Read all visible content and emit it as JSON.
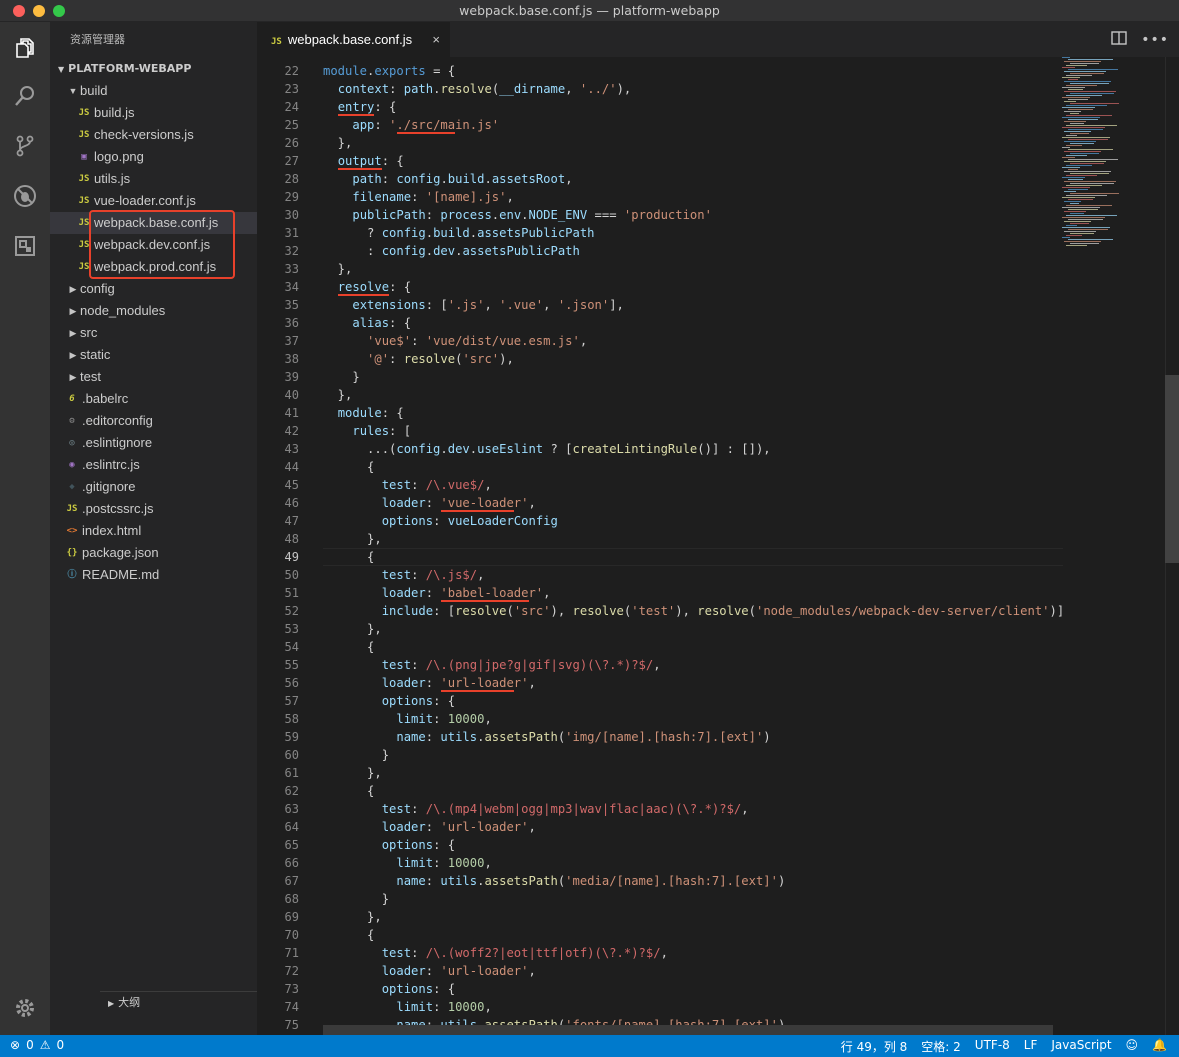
{
  "window": {
    "title": "webpack.base.conf.js — platform-webapp"
  },
  "activity_bar": {
    "items": [
      "explorer-icon",
      "search-icon",
      "source-control-icon",
      "debug-icon",
      "extensions-icon"
    ],
    "bottom": "gear-icon"
  },
  "sidebar": {
    "header": "资源管理器",
    "section": "PLATFORM-WEBAPP",
    "tree": [
      {
        "label": "build",
        "type": "folder-open",
        "depth": 0
      },
      {
        "label": "build.js",
        "type": "js",
        "depth": 1
      },
      {
        "label": "check-versions.js",
        "type": "js",
        "depth": 1
      },
      {
        "label": "logo.png",
        "type": "img",
        "depth": 1
      },
      {
        "label": "utils.js",
        "type": "js",
        "depth": 1
      },
      {
        "label": "vue-loader.conf.js",
        "type": "js",
        "depth": 1
      },
      {
        "label": "webpack.base.conf.js",
        "type": "js",
        "depth": 1,
        "selected": true
      },
      {
        "label": "webpack.dev.conf.js",
        "type": "js",
        "depth": 1
      },
      {
        "label": "webpack.prod.conf.js",
        "type": "js",
        "depth": 1
      },
      {
        "label": "config",
        "type": "folder",
        "depth": 0
      },
      {
        "label": "node_modules",
        "type": "folder",
        "depth": 0
      },
      {
        "label": "src",
        "type": "folder",
        "depth": 0
      },
      {
        "label": "static",
        "type": "folder",
        "depth": 0
      },
      {
        "label": "test",
        "type": "folder",
        "depth": 0
      },
      {
        "label": ".babelrc",
        "type": "babel",
        "depth": 0
      },
      {
        "label": ".editorconfig",
        "type": "cfg",
        "depth": 0
      },
      {
        "label": ".eslintignore",
        "type": "eslintig",
        "depth": 0
      },
      {
        "label": ".eslintrc.js",
        "type": "eslintrc",
        "depth": 0
      },
      {
        "label": ".gitignore",
        "type": "git",
        "depth": 0
      },
      {
        "label": ".postcssrc.js",
        "type": "js",
        "depth": 0
      },
      {
        "label": "index.html",
        "type": "html",
        "depth": 0
      },
      {
        "label": "package.json",
        "type": "json",
        "depth": 0
      },
      {
        "label": "README.md",
        "type": "info",
        "depth": 0
      }
    ],
    "outline": "大纲"
  },
  "tab": {
    "icon": "JS",
    "label": "webpack.base.conf.js",
    "close": "×"
  },
  "tab_actions": [
    "split-editor-icon",
    "more-icon"
  ],
  "editor": {
    "first_line": 22,
    "current_line": 49,
    "lines": [
      [
        [
          "k",
          "module"
        ],
        [
          "p",
          "."
        ],
        [
          "k",
          "exports"
        ],
        [
          "p",
          " = {"
        ]
      ],
      [
        [
          "p",
          "  "
        ],
        [
          "v",
          "context"
        ],
        [
          "p",
          ": "
        ],
        [
          "v",
          "path"
        ],
        [
          "p",
          "."
        ],
        [
          "f",
          "resolve"
        ],
        [
          "p",
          "("
        ],
        [
          "v",
          "__dirname"
        ],
        [
          "p",
          ", "
        ],
        [
          "s",
          "'../'"
        ],
        [
          "p",
          "),"
        ]
      ],
      [
        [
          "p",
          "  "
        ],
        [
          "v",
          "entry"
        ],
        [
          "p",
          ": {"
        ]
      ],
      [
        [
          "p",
          "    "
        ],
        [
          "v",
          "app"
        ],
        [
          "p",
          ": "
        ],
        [
          "s",
          "'./src/main.js'"
        ]
      ],
      [
        [
          "p",
          "  },"
        ]
      ],
      [
        [
          "p",
          "  "
        ],
        [
          "v",
          "output"
        ],
        [
          "p",
          ": {"
        ]
      ],
      [
        [
          "p",
          "    "
        ],
        [
          "v",
          "path"
        ],
        [
          "p",
          ": "
        ],
        [
          "v",
          "config"
        ],
        [
          "p",
          "."
        ],
        [
          "v",
          "build"
        ],
        [
          "p",
          "."
        ],
        [
          "v",
          "assetsRoot"
        ],
        [
          "p",
          ","
        ]
      ],
      [
        [
          "p",
          "    "
        ],
        [
          "v",
          "filename"
        ],
        [
          "p",
          ": "
        ],
        [
          "s",
          "'[name].js'"
        ],
        [
          "p",
          ","
        ]
      ],
      [
        [
          "p",
          "    "
        ],
        [
          "v",
          "publicPath"
        ],
        [
          "p",
          ": "
        ],
        [
          "v",
          "process"
        ],
        [
          "p",
          "."
        ],
        [
          "v",
          "env"
        ],
        [
          "p",
          "."
        ],
        [
          "v",
          "NODE_ENV"
        ],
        [
          "p",
          " === "
        ],
        [
          "s",
          "'production'"
        ]
      ],
      [
        [
          "p",
          "      ? "
        ],
        [
          "v",
          "config"
        ],
        [
          "p",
          "."
        ],
        [
          "v",
          "build"
        ],
        [
          "p",
          "."
        ],
        [
          "v",
          "assetsPublicPath"
        ]
      ],
      [
        [
          "p",
          "      : "
        ],
        [
          "v",
          "config"
        ],
        [
          "p",
          "."
        ],
        [
          "v",
          "dev"
        ],
        [
          "p",
          "."
        ],
        [
          "v",
          "assetsPublicPath"
        ]
      ],
      [
        [
          "p",
          "  },"
        ]
      ],
      [
        [
          "p",
          "  "
        ],
        [
          "v",
          "resolve"
        ],
        [
          "p",
          ": {"
        ]
      ],
      [
        [
          "p",
          "    "
        ],
        [
          "v",
          "extensions"
        ],
        [
          "p",
          ": ["
        ],
        [
          "s",
          "'.js'"
        ],
        [
          "p",
          ", "
        ],
        [
          "s",
          "'.vue'"
        ],
        [
          "p",
          ", "
        ],
        [
          "s",
          "'.json'"
        ],
        [
          "p",
          "],"
        ]
      ],
      [
        [
          "p",
          "    "
        ],
        [
          "v",
          "alias"
        ],
        [
          "p",
          ": {"
        ]
      ],
      [
        [
          "p",
          "      "
        ],
        [
          "s",
          "'vue$'"
        ],
        [
          "p",
          ": "
        ],
        [
          "s",
          "'vue/dist/vue.esm.js'"
        ],
        [
          "p",
          ","
        ]
      ],
      [
        [
          "p",
          "      "
        ],
        [
          "s",
          "'@'"
        ],
        [
          "p",
          ": "
        ],
        [
          "f",
          "resolve"
        ],
        [
          "p",
          "("
        ],
        [
          "s",
          "'src'"
        ],
        [
          "p",
          "),"
        ]
      ],
      [
        [
          "p",
          "    }"
        ]
      ],
      [
        [
          "p",
          "  },"
        ]
      ],
      [
        [
          "p",
          "  "
        ],
        [
          "v",
          "module"
        ],
        [
          "p",
          ": {"
        ]
      ],
      [
        [
          "p",
          "    "
        ],
        [
          "v",
          "rules"
        ],
        [
          "p",
          ": ["
        ]
      ],
      [
        [
          "p",
          "      ...("
        ],
        [
          "v",
          "config"
        ],
        [
          "p",
          "."
        ],
        [
          "v",
          "dev"
        ],
        [
          "p",
          "."
        ],
        [
          "v",
          "useEslint"
        ],
        [
          "p",
          " ? ["
        ],
        [
          "f",
          "createLintingRule"
        ],
        [
          "p",
          "()] : []),"
        ]
      ],
      [
        [
          "p",
          "      {"
        ]
      ],
      [
        [
          "p",
          "        "
        ],
        [
          "v",
          "test"
        ],
        [
          "p",
          ": "
        ],
        [
          "r",
          "/\\.vue$/"
        ],
        [
          "p",
          ","
        ]
      ],
      [
        [
          "p",
          "        "
        ],
        [
          "v",
          "loader"
        ],
        [
          "p",
          ": "
        ],
        [
          "s",
          "'vue-loader'"
        ],
        [
          "p",
          ","
        ]
      ],
      [
        [
          "p",
          "        "
        ],
        [
          "v",
          "options"
        ],
        [
          "p",
          ": "
        ],
        [
          "v",
          "vueLoaderConfig"
        ]
      ],
      [
        [
          "p",
          "      },"
        ]
      ],
      [
        [
          "p",
          "      {"
        ]
      ],
      [
        [
          "p",
          "        "
        ],
        [
          "v",
          "test"
        ],
        [
          "p",
          ": "
        ],
        [
          "r",
          "/\\.js$/"
        ],
        [
          "p",
          ","
        ]
      ],
      [
        [
          "p",
          "        "
        ],
        [
          "v",
          "loader"
        ],
        [
          "p",
          ": "
        ],
        [
          "s",
          "'babel-loader'"
        ],
        [
          "p",
          ","
        ]
      ],
      [
        [
          "p",
          "        "
        ],
        [
          "v",
          "include"
        ],
        [
          "p",
          ": ["
        ],
        [
          "f",
          "resolve"
        ],
        [
          "p",
          "("
        ],
        [
          "s",
          "'src'"
        ],
        [
          "p",
          "), "
        ],
        [
          "f",
          "resolve"
        ],
        [
          "p",
          "("
        ],
        [
          "s",
          "'test'"
        ],
        [
          "p",
          "), "
        ],
        [
          "f",
          "resolve"
        ],
        [
          "p",
          "("
        ],
        [
          "s",
          "'node_modules/webpack-dev-server/client'"
        ],
        [
          "p",
          ")]"
        ]
      ],
      [
        [
          "p",
          "      },"
        ]
      ],
      [
        [
          "p",
          "      {"
        ]
      ],
      [
        [
          "p",
          "        "
        ],
        [
          "v",
          "test"
        ],
        [
          "p",
          ": "
        ],
        [
          "r",
          "/\\.(png|jpe?g|gif|svg)(\\?.*)?$/"
        ],
        [
          "p",
          ","
        ]
      ],
      [
        [
          "p",
          "        "
        ],
        [
          "v",
          "loader"
        ],
        [
          "p",
          ": "
        ],
        [
          "s",
          "'url-loader'"
        ],
        [
          "p",
          ","
        ]
      ],
      [
        [
          "p",
          "        "
        ],
        [
          "v",
          "options"
        ],
        [
          "p",
          ": {"
        ]
      ],
      [
        [
          "p",
          "          "
        ],
        [
          "v",
          "limit"
        ],
        [
          "p",
          ": "
        ],
        [
          "n",
          "10000"
        ],
        [
          "p",
          ","
        ]
      ],
      [
        [
          "p",
          "          "
        ],
        [
          "v",
          "name"
        ],
        [
          "p",
          ": "
        ],
        [
          "v",
          "utils"
        ],
        [
          "p",
          "."
        ],
        [
          "f",
          "assetsPath"
        ],
        [
          "p",
          "("
        ],
        [
          "s",
          "'img/[name].[hash:7].[ext]'"
        ],
        [
          "p",
          ")"
        ]
      ],
      [
        [
          "p",
          "        }"
        ]
      ],
      [
        [
          "p",
          "      },"
        ]
      ],
      [
        [
          "p",
          "      {"
        ]
      ],
      [
        [
          "p",
          "        "
        ],
        [
          "v",
          "test"
        ],
        [
          "p",
          ": "
        ],
        [
          "r",
          "/\\.(mp4|webm|ogg|mp3|wav|flac|aac)(\\?.*)?$/"
        ],
        [
          "p",
          ","
        ]
      ],
      [
        [
          "p",
          "        "
        ],
        [
          "v",
          "loader"
        ],
        [
          "p",
          ": "
        ],
        [
          "s",
          "'url-loader'"
        ],
        [
          "p",
          ","
        ]
      ],
      [
        [
          "p",
          "        "
        ],
        [
          "v",
          "options"
        ],
        [
          "p",
          ": {"
        ]
      ],
      [
        [
          "p",
          "          "
        ],
        [
          "v",
          "limit"
        ],
        [
          "p",
          ": "
        ],
        [
          "n",
          "10000"
        ],
        [
          "p",
          ","
        ]
      ],
      [
        [
          "p",
          "          "
        ],
        [
          "v",
          "name"
        ],
        [
          "p",
          ": "
        ],
        [
          "v",
          "utils"
        ],
        [
          "p",
          "."
        ],
        [
          "f",
          "assetsPath"
        ],
        [
          "p",
          "("
        ],
        [
          "s",
          "'media/[name].[hash:7].[ext]'"
        ],
        [
          "p",
          ")"
        ]
      ],
      [
        [
          "p",
          "        }"
        ]
      ],
      [
        [
          "p",
          "      },"
        ]
      ],
      [
        [
          "p",
          "      {"
        ]
      ],
      [
        [
          "p",
          "        "
        ],
        [
          "v",
          "test"
        ],
        [
          "p",
          ": "
        ],
        [
          "r",
          "/\\.(woff2?|eot|ttf|otf)(\\?.*)?$/"
        ],
        [
          "p",
          ","
        ]
      ],
      [
        [
          "p",
          "        "
        ],
        [
          "v",
          "loader"
        ],
        [
          "p",
          ": "
        ],
        [
          "s",
          "'url-loader'"
        ],
        [
          "p",
          ","
        ]
      ],
      [
        [
          "p",
          "        "
        ],
        [
          "v",
          "options"
        ],
        [
          "p",
          ": {"
        ]
      ],
      [
        [
          "p",
          "          "
        ],
        [
          "v",
          "limit"
        ],
        [
          "p",
          ": "
        ],
        [
          "n",
          "10000"
        ],
        [
          "p",
          ","
        ]
      ],
      [
        [
          "p",
          "          "
        ],
        [
          "v",
          "name"
        ],
        [
          "p",
          ": "
        ],
        [
          "v",
          "utils"
        ],
        [
          "p",
          "."
        ],
        [
          "f",
          "assetsPath"
        ],
        [
          "p",
          "("
        ],
        [
          "s",
          "'fonts/[name].[hash:7].[ext]'"
        ],
        [
          "p",
          ")"
        ]
      ]
    ]
  },
  "status": {
    "errors": "0",
    "warnings": "0",
    "position": "行 49，列 8",
    "indent": "空格: 2",
    "encoding": "UTF-8",
    "eol": "LF",
    "language": "JavaScript"
  },
  "colors": {
    "accent": "#007acc",
    "annotation": "#e8412b"
  }
}
